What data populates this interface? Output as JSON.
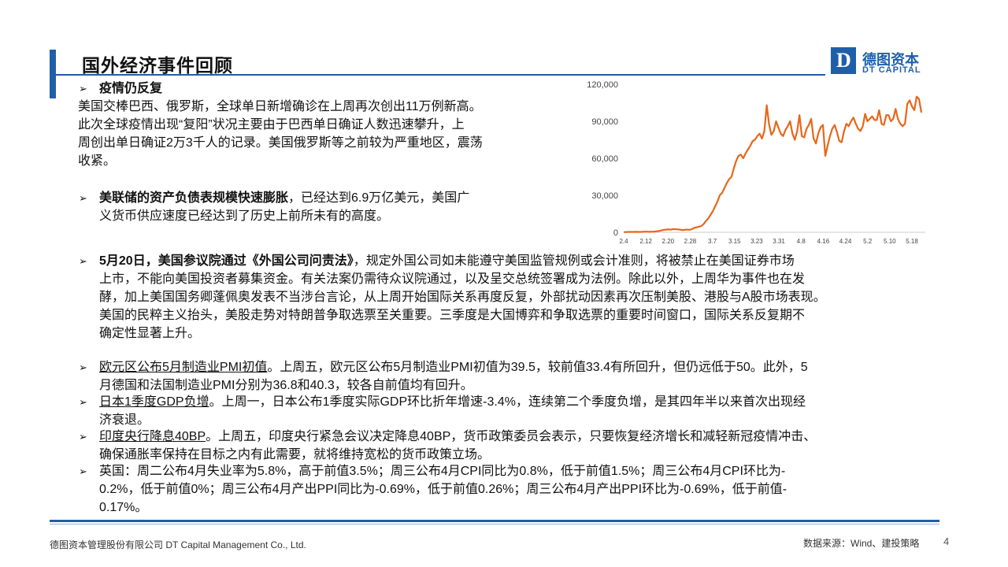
{
  "header": {
    "title": "国外经济事件回顾",
    "logo_letter": "D",
    "logo_cn": "德图资本",
    "logo_en": "DT CAPITAL"
  },
  "section1": {
    "bullet": "➢",
    "heading": "疫情仍反复",
    "lines": [
      "美国交棒巴西、俄罗斯，全球单日新增确诊在上周再次创出11万例新高。",
      "此次全球疫情出现“复阳”状况主要由于巴西单日确证人数迅速攀升，上",
      "周创出单日确证2万3千人的记录。美国俄罗斯等之前较为严重地区，震荡",
      "收紧。"
    ]
  },
  "section2": {
    "bullet": "➢",
    "heading": "美联储的资产负债表规模快速膨胀",
    "line1_rest": "，已经达到6.9万亿美元，美国广",
    "line2": "义货币供应速度已经达到了历史上前所未有的高度。"
  },
  "section3": {
    "bullet": "➢",
    "heading": "5月20日，美国参议院通过《外国公司问责法》",
    "line1_rest": "，规定外国公司如未能遵守美国监管规例或会计准则，将被禁止在美国证券市场",
    "lines": [
      "上市，不能向美国投资者募集资金。有关法案仍需待众议院通过，以及呈交总统签署成为法例。除此以外，上周华为事件也在发",
      "酵，加上美国国务卿蓬佩奥发表不当涉台言论，从上周开始国际关系再度反复，外部扰动因素再次压制美股、港股与A股市场表现。",
      "美国的民粹主义抬头，美股走势对特朗普争取选票至关重要。三季度是大国博弈和争取选票的重要时间窗口，国际关系反复期不",
      "确定性显著上升。"
    ]
  },
  "items": [
    {
      "bullet": "➢",
      "head": "欧元区公布5月制造业PMI初值",
      "rest": "。上周五，欧元区公布5月制造业PMI初值为39.5，较前值33.4有所回升，但仍远低于50。此外，5",
      "lines": [
        "月德国和法国制造业PMI分别为36.8和40.3，较各自前值均有回升。"
      ]
    },
    {
      "bullet": "➢",
      "head": "日本1季度GDP负增",
      "rest": "。上周一，日本公布1季度实际GDP环比折年增速-3.4%，连续第二个季度负增，是其四年半以来首次出现经",
      "lines": [
        "济衰退。"
      ]
    },
    {
      "bullet": "➢",
      "head": "印度央行降息40BP",
      "rest": "。上周五，印度央行紧急会议决定降息40BP，货币政策委员会表示，只要恢复经济增长和减轻新冠疫情冲击、",
      "lines": [
        "确保通胀率保持在目标之内有此需要，就将维持宽松的货币政策立场。"
      ]
    },
    {
      "bullet": "➢",
      "head": "",
      "rest": "英国：周二公布4月失业率为5.8%，高于前值3.5%；周三公布4月CPI同比为0.8%，低于前值1.5%；周三公布4月CPI环比为-",
      "lines": [
        "0.2%，低于前值0%；周三公布4月产出PPI同比为-0.69%，低于前值0.26%；周三公布4月产出PPI环比为-0.69%，低于前值-",
        "0.17%。"
      ]
    }
  ],
  "chart_data": {
    "type": "line",
    "title": "",
    "xlabel": "",
    "ylabel": "",
    "ylim": [
      0,
      120000
    ],
    "yticks": [
      "0",
      "30,000",
      "60,000",
      "90,000",
      "120,000"
    ],
    "ytick_values": [
      0,
      30000,
      60000,
      90000,
      120000
    ],
    "xticks": [
      "2.4",
      "2.12",
      "2.20",
      "2.28",
      "3.7",
      "3.15",
      "3.23",
      "3.31",
      "4.8",
      "4.16",
      "4.24",
      "5.2",
      "5.10",
      "5.18"
    ],
    "color": "#e8661a",
    "grid": false,
    "series": [
      {
        "values": [
          200,
          200,
          300,
          300,
          300,
          400,
          300,
          300,
          400,
          500,
          500,
          400,
          500,
          600,
          800,
          1000,
          1500,
          2000,
          2200,
          2400,
          2100,
          2600,
          2500,
          2400,
          2200,
          1800,
          2000,
          2300,
          2000,
          2500,
          3500,
          4000,
          4500,
          5000,
          6500,
          9000,
          11000,
          14000,
          17000,
          21000,
          25000,
          30000,
          32000,
          36000,
          40000,
          43000,
          45000,
          52000,
          58000,
          62000,
          63000,
          60000,
          64000,
          67000,
          70000,
          74000,
          75000,
          78000,
          80000,
          76000,
          82000,
          103000,
          88000,
          79000,
          82000,
          90000,
          85000,
          80000,
          78000,
          83000,
          86000,
          90000,
          80000,
          75000,
          82000,
          95000,
          78000,
          77000,
          84000,
          87000,
          92000,
          76000,
          72000,
          80000,
          85000,
          87000,
          62000,
          70000,
          78000,
          84000,
          87000,
          81000,
          74000,
          73000,
          82000,
          88000,
          86000,
          90000,
          93000,
          88000,
          84000,
          82000,
          86000,
          96000,
          90000,
          92000,
          94000,
          91000,
          91000,
          99000,
          88000,
          87000,
          95000,
          95000,
          90000,
          92000,
          100000,
          92000,
          88000,
          86000,
          88000,
          104000,
          107000,
          102000,
          99000,
          110000,
          108000,
          97000
        ]
      }
    ]
  },
  "footer": {
    "company": "德图资本管理股份有限公司  DT Capital  Management  Co., Ltd.",
    "source": "数据来源：Wind、建投策略",
    "page": "4"
  }
}
